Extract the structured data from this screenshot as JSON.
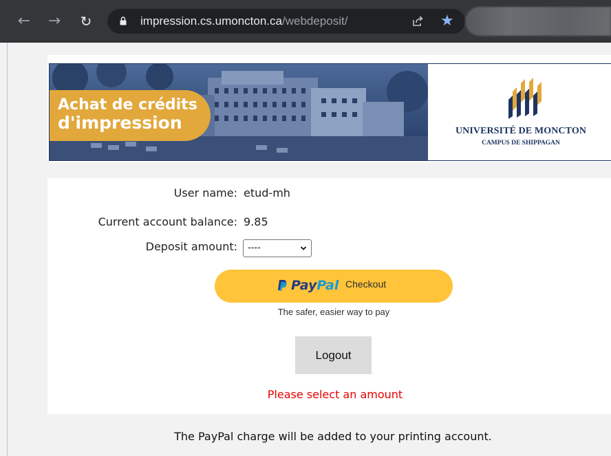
{
  "browser": {
    "url_host": "impression.cs.umoncton.ca",
    "url_path": "/webdeposit/",
    "icons": {
      "back": "arrow-left-icon",
      "forward": "arrow-right-icon",
      "reload": "reload-icon",
      "lock": "lock-icon",
      "share": "share-icon",
      "bookmark": "star-icon"
    }
  },
  "banner": {
    "title_line1": "Achat de crédits",
    "title_line2": "d'impression",
    "university_name": "UNIVERSITÉ DE MONCTON",
    "campus_name": "CAMPUS DE SHIPPAGAN",
    "colors": {
      "navy": "#1e3561",
      "gold": "#e2a83c"
    }
  },
  "form": {
    "username_label": "User name:",
    "username_value": "etud-mh",
    "balance_label": "Current account balance:",
    "balance_value": "9.85",
    "deposit_label": "Deposit amount:",
    "deposit_selected": "----"
  },
  "paypal": {
    "word_pay": "Pay",
    "word_pal": "Pal",
    "checkout_label": "Checkout",
    "tagline": "The safer, easier way to pay",
    "colors": {
      "button": "#ffc439",
      "pay": "#253b80",
      "pal": "#179bd7"
    }
  },
  "logout_label": "Logout",
  "error_message": "Please select an amount",
  "footer_note": "The PayPal charge will be added to your printing account."
}
